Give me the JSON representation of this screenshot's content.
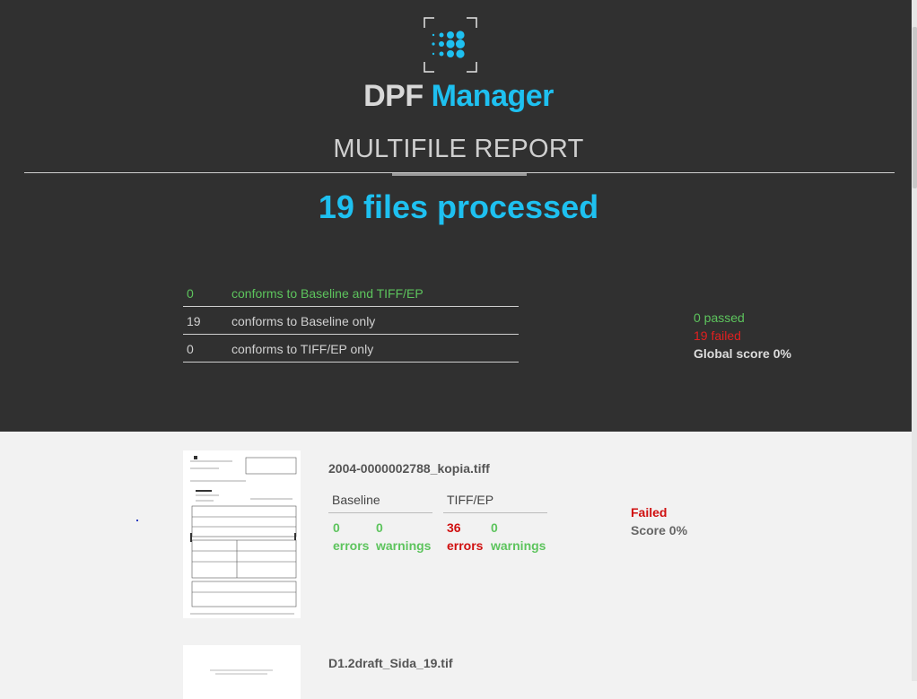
{
  "header": {
    "brand_part1": "DPF",
    "brand_part2": "Manager",
    "report_title": "MULTIFILE REPORT",
    "files_processed": "19 files processed"
  },
  "conformance": [
    {
      "count": "0",
      "label": "conforms to Baseline and TIFF/EP"
    },
    {
      "count": "19",
      "label": "conforms to Baseline only"
    },
    {
      "count": "0",
      "label": "conforms to TIFF/EP only"
    }
  ],
  "summary": {
    "passed": "0 passed",
    "failed": "19 failed",
    "global_score": "Global score 0%"
  },
  "files": [
    {
      "name": "2004-0000002788_kopia.tiff",
      "baseline_label": "Baseline",
      "tiffep_label": "TIFF/EP",
      "baseline_errors": "0",
      "baseline_warnings": "0",
      "tiffep_errors": "36",
      "tiffep_warnings": "0",
      "errors_label": "errors",
      "warnings_label": "warnings",
      "status": "Failed",
      "score": "Score 0%"
    },
    {
      "name": "D1.2draft_Sida_19.tif"
    }
  ],
  "colors": {
    "accent": "#1ec0f0",
    "header_bg": "#303030",
    "pass": "#5dc45d",
    "fail": "#d01010"
  }
}
